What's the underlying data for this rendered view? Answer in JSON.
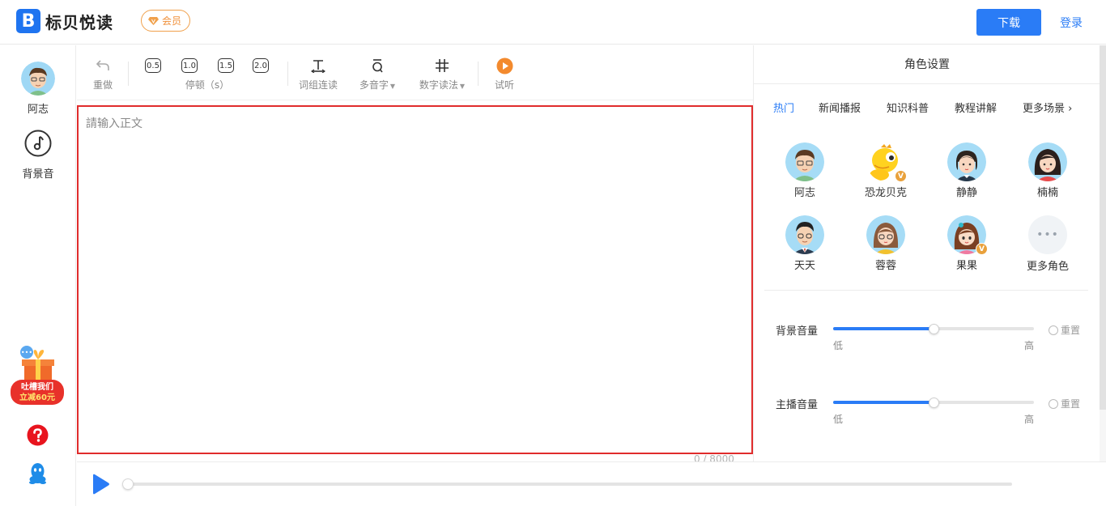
{
  "header": {
    "logo_mark": "B",
    "logo_text": "标贝悦读",
    "vip_label": "会员",
    "download_label": "下载",
    "login_label": "登录"
  },
  "sidebar": {
    "voice_label": "阿志",
    "music_label": "背景音",
    "promo_line1": "吐槽我们",
    "promo_line2": "立减60元"
  },
  "toolbar": {
    "redo_label": "重做",
    "pause_options": [
      "0.5",
      "1.0",
      "1.5",
      "2.0"
    ],
    "pause_label": "停顿（s）",
    "phrase_label": "词组连读",
    "polyphone_label": "多音字",
    "number_label": "数字读法",
    "preview_label": "试听"
  },
  "editor": {
    "placeholder": "請输入正文",
    "char_count": "0 / 8000"
  },
  "player": {
    "progress": 0
  },
  "panel": {
    "title": "角色设置",
    "tabs": [
      "热门",
      "新闻播报",
      "知识科普",
      "教程讲解",
      "更多场景 ›"
    ],
    "active_tab": 0,
    "roles": [
      {
        "name": "阿志",
        "vip": false
      },
      {
        "name": "恐龙贝克",
        "vip": true
      },
      {
        "name": "静静",
        "vip": false
      },
      {
        "name": "楠楠",
        "vip": false
      },
      {
        "name": "天天",
        "vip": false
      },
      {
        "name": "蓉蓉",
        "vip": false
      },
      {
        "name": "果果",
        "vip": true
      },
      {
        "name": "更多角色",
        "vip": false
      }
    ],
    "vip_mark": "V",
    "bg_volume": {
      "label": "背景音量",
      "value": 0.5,
      "low": "低",
      "high": "高",
      "reset": "重置"
    },
    "host_volume": {
      "label": "主播音量",
      "value": 0.5,
      "low": "低",
      "high": "高",
      "reset": "重置"
    }
  },
  "colors": {
    "accent": "#2a7cf6",
    "vip": "#f0903a",
    "editor_border": "#e02c2c"
  }
}
